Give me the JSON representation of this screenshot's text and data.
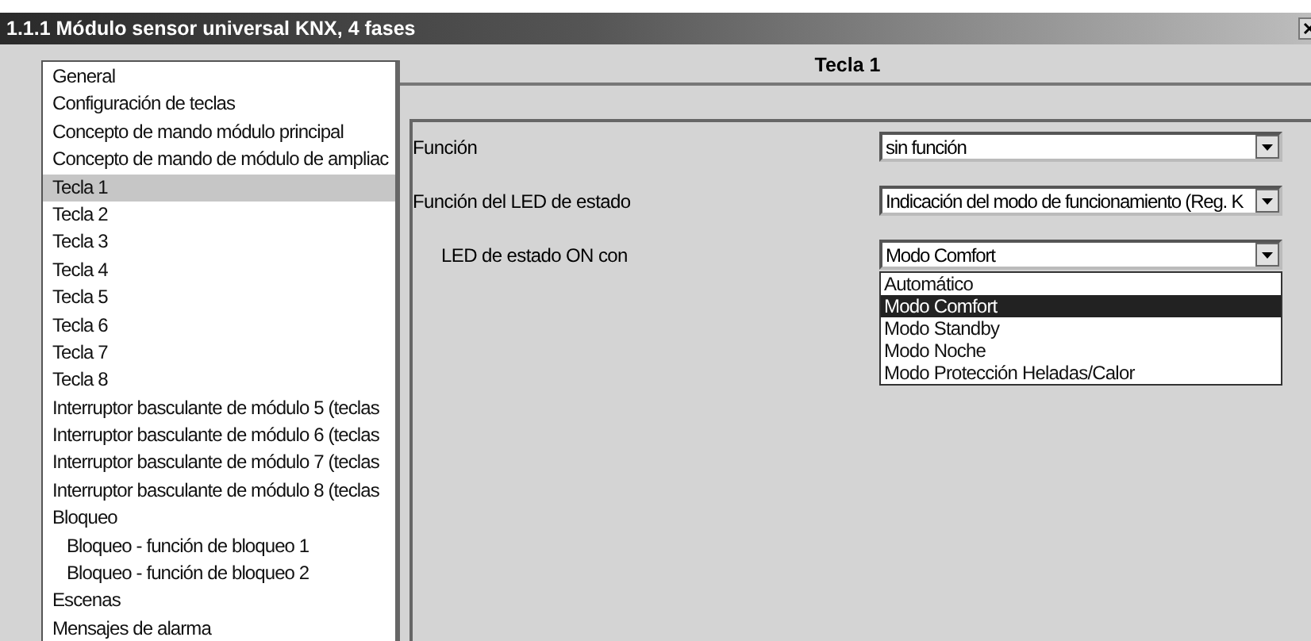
{
  "window": {
    "title": "1.1.1 Módulo sensor universal KNX, 4 fases"
  },
  "sidebar": {
    "items": [
      {
        "label": "General",
        "selected": false
      },
      {
        "label": "Configuración de teclas",
        "selected": false
      },
      {
        "label": "Concepto de mando módulo principal",
        "selected": false
      },
      {
        "label": "Concepto de mando de módulo de ampliac",
        "selected": false
      },
      {
        "label": "Tecla 1",
        "selected": true
      },
      {
        "label": "Tecla 2",
        "selected": false
      },
      {
        "label": "Tecla 3",
        "selected": false
      },
      {
        "label": "Tecla 4",
        "selected": false
      },
      {
        "label": "Tecla 5",
        "selected": false
      },
      {
        "label": "Tecla 6",
        "selected": false
      },
      {
        "label": "Tecla 7",
        "selected": false
      },
      {
        "label": "Tecla 8",
        "selected": false
      },
      {
        "label": "Interruptor basculante de módulo 5 (teclas",
        "selected": false
      },
      {
        "label": "Interruptor basculante de módulo 6 (teclas",
        "selected": false
      },
      {
        "label": "Interruptor basculante de módulo 7 (teclas",
        "selected": false
      },
      {
        "label": "Interruptor basculante de módulo 8 (teclas",
        "selected": false
      },
      {
        "label": "Bloqueo",
        "selected": false,
        "children": [
          {
            "label": "Bloqueo - función de bloqueo 1",
            "selected": false
          },
          {
            "label": "Bloqueo - función de bloqueo 2",
            "selected": false
          }
        ]
      },
      {
        "label": "Escenas",
        "selected": false
      },
      {
        "label": "Mensajes de alarma",
        "selected": false
      }
    ]
  },
  "panel": {
    "title": "Tecla 1",
    "parameters": [
      {
        "label": "Función",
        "value": "sin función"
      },
      {
        "label": "Función del LED de estado",
        "value": "Indicación del modo de funcionamiento (Reg. K",
        "children": [
          {
            "label": "LED de estado ON con",
            "value": "Modo Comfort",
            "options": [
              {
                "label": "Automático",
                "selected": false
              },
              {
                "label": "Modo Comfort",
                "selected": true
              },
              {
                "label": "Modo Standby",
                "selected": false
              },
              {
                "label": "Modo Noche",
                "selected": false
              },
              {
                "label": "Modo Protección Heladas/Calor",
                "selected": false
              }
            ]
          }
        ]
      }
    ]
  }
}
